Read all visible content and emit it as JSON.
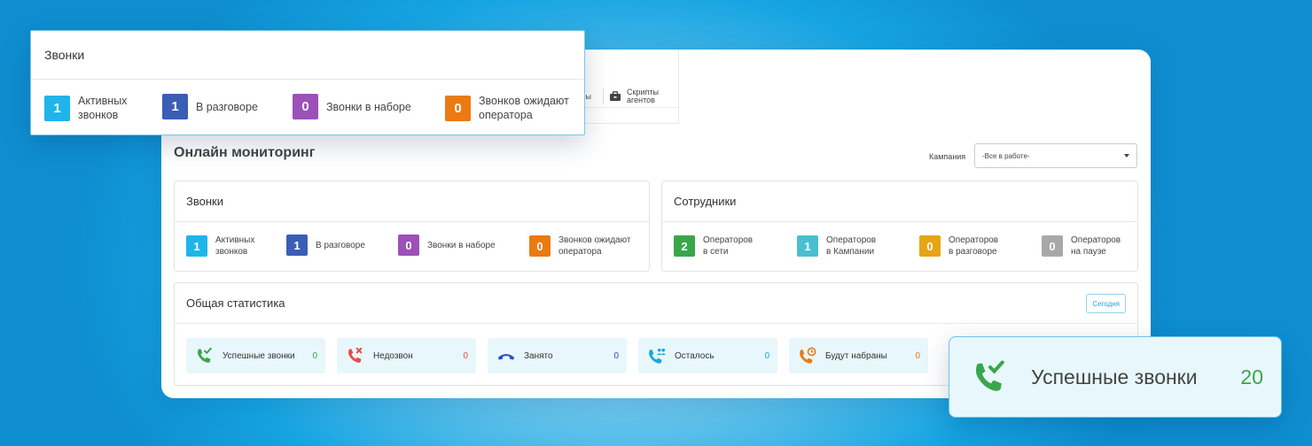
{
  "toolbar": {
    "cut_label": "сы",
    "scripts_label_line1": "Скрипты",
    "scripts_label_line2": "агентов"
  },
  "page": {
    "title": "Онлайн мониторинг",
    "campaign_label": "Кампания",
    "campaign_value": "-Все в работе-"
  },
  "calls": {
    "title": "Звонки",
    "items": [
      {
        "value": "1",
        "label_line1": "Активных",
        "label_line2": "звонков",
        "color": "#1fb5ea"
      },
      {
        "value": "1",
        "label_line1": "В разговоре",
        "label_line2": "",
        "color": "#3b5db6"
      },
      {
        "value": "0",
        "label_line1": "Звонки в наборе",
        "label_line2": "",
        "color": "#9b51b8"
      },
      {
        "value": "0",
        "label_line1": "Звонков ожидают",
        "label_line2": "оператора",
        "color": "#ea7a12"
      }
    ]
  },
  "staff": {
    "title": "Сотрудники",
    "items": [
      {
        "value": "2",
        "label_line1": "Операторов",
        "label_line2": "в сети",
        "color": "#3aa64b"
      },
      {
        "value": "1",
        "label_line1": "Операторов",
        "label_line2": "в Кампании",
        "color": "#49bfcf"
      },
      {
        "value": "0",
        "label_line1": "Операторов",
        "label_line2": "в разговоре",
        "color": "#e6a417"
      },
      {
        "value": "0",
        "label_line1": "Операторов",
        "label_line2": "на паузе",
        "color": "#a8a8a8"
      }
    ]
  },
  "stats": {
    "title": "Общая статистика",
    "today_label": "Сегодня",
    "items": [
      {
        "icon": "phone-check-icon",
        "label": "Успешные звонки",
        "value": "0",
        "color": "#3aa64b"
      },
      {
        "icon": "phone-missed-icon",
        "label": "Недозвон",
        "value": "0",
        "color": "#e84b4b"
      },
      {
        "icon": "phone-hangup-icon",
        "label": "Занято",
        "value": "0",
        "color": "#2b4fbf"
      },
      {
        "icon": "phone-group-icon",
        "label": "Осталось",
        "value": "0",
        "color": "#1aa6dd"
      },
      {
        "icon": "phone-clock-icon",
        "label": "Будут набраны",
        "value": "0",
        "color": "#ea7a12"
      }
    ]
  },
  "highlight": {
    "icon": "phone-check-icon",
    "label": "Успешные звонки",
    "value": "20",
    "color": "#3aa64b"
  }
}
